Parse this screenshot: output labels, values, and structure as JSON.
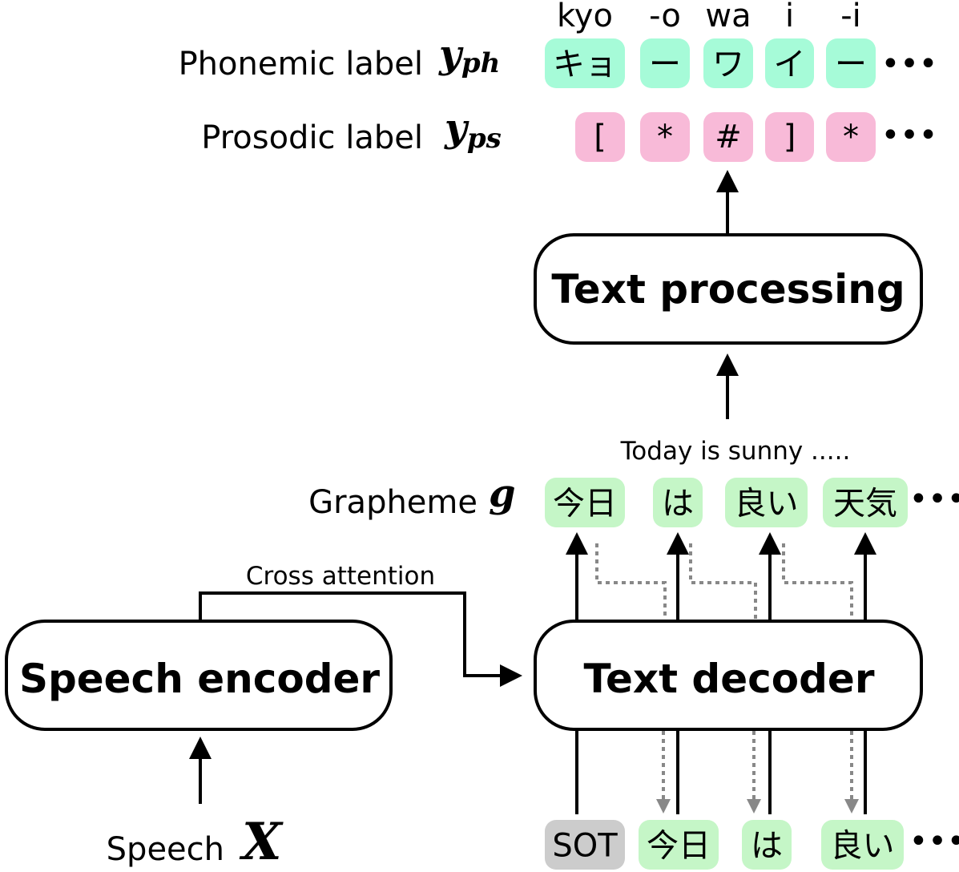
{
  "colors": {
    "phonemic": "#a6fbd8",
    "prosodic": "#f8bad8",
    "grapheme": "#c5f6c7",
    "sot": "#cccccc",
    "dotted": "#888888"
  },
  "phonemic": {
    "label": "Phonemic label",
    "symbol": "y",
    "subscript": "ph",
    "romaji": [
      "kyo",
      "-o",
      "wa",
      "i",
      "-i"
    ],
    "tokens": [
      "キョ",
      "ー",
      "ワ",
      "イ",
      "ー"
    ],
    "ellipsis": "•••"
  },
  "prosodic": {
    "label": "Prosodic label",
    "symbol": "y",
    "subscript": "ps",
    "tokens": [
      "[",
      "*",
      "#",
      "]",
      "*"
    ],
    "ellipsis": "•••"
  },
  "text_processing": {
    "title": "Text processing"
  },
  "translation": "Today is sunny .....",
  "grapheme": {
    "label": "Grapheme",
    "symbol": "g",
    "tokens": [
      "今日",
      "は",
      "良い",
      "天気"
    ],
    "ellipsis": "•••"
  },
  "cross_attention": "Cross attention",
  "speech_encoder": {
    "title": "Speech encoder"
  },
  "text_decoder": {
    "title": "Text decoder"
  },
  "decoder_input": {
    "tokens": [
      "SOT",
      "今日",
      "は",
      "良い"
    ],
    "ellipsis": "•••"
  },
  "speech": {
    "label": "Speech",
    "symbol": "X"
  }
}
